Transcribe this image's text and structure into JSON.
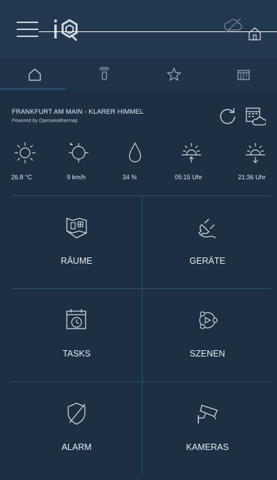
{
  "header": {
    "menu_icon": "hamburger-menu-icon",
    "logo_icon": "iq-logo-icon",
    "cloud_status_icon": "cloud-off-icon",
    "home_icon": "home-icon"
  },
  "tabs": [
    {
      "icon": "home-icon",
      "active": true
    },
    {
      "icon": "remote-sensor-icon",
      "active": false
    },
    {
      "icon": "star-icon",
      "active": false
    },
    {
      "icon": "calendar-icon",
      "active": false
    }
  ],
  "weather": {
    "title": "FRANKFURT AM MAIN - KLARER HIMMEL",
    "powered_by": "Powered by Openweathermap",
    "stats": [
      {
        "icon": "sun-icon",
        "value": "26.8 °C"
      },
      {
        "icon": "wind-icon",
        "value": "9 km/h"
      },
      {
        "icon": "humidity-drop-icon",
        "value": "34 %"
      },
      {
        "icon": "sunrise-icon",
        "value": "05:15 Uhr"
      },
      {
        "icon": "sunset-icon",
        "value": "21:36 Uhr"
      }
    ]
  },
  "tiles": [
    {
      "label": "RÄUME",
      "icon": "rooms-map-icon"
    },
    {
      "label": "GERÄTE",
      "icon": "plug-icon"
    },
    {
      "label": "TASKS",
      "icon": "calendar-clock-icon"
    },
    {
      "label": "SZENEN",
      "icon": "scenes-icon"
    },
    {
      "label": "ALARM",
      "icon": "shield-off-icon"
    },
    {
      "label": "KAMERAS",
      "icon": "camera-icon"
    }
  ],
  "colors": {
    "background": "#1c2f43",
    "header": "#22384e",
    "divider": "#33506b",
    "icon": "#cfd8e2"
  }
}
